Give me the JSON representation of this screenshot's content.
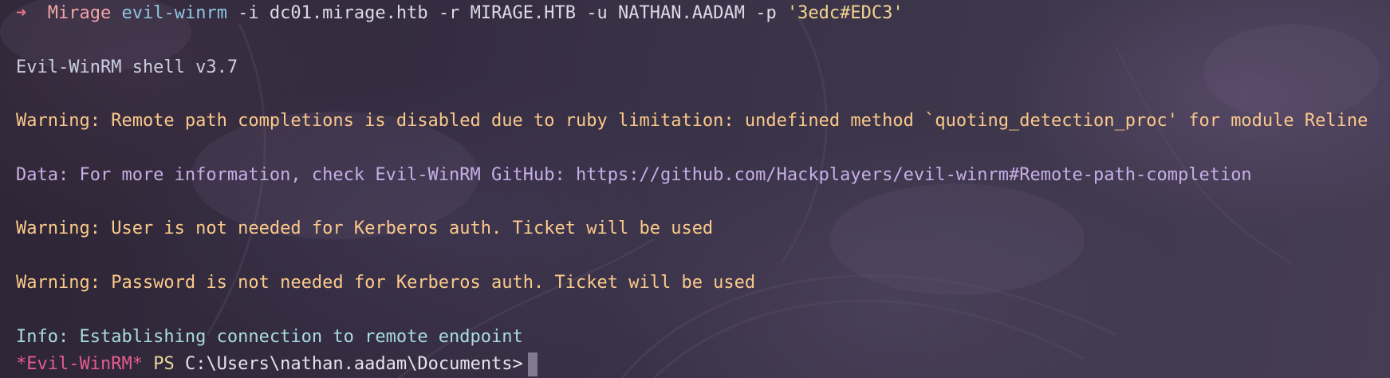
{
  "prompt": {
    "arrow": "➜",
    "directory": "Mirage",
    "command": "evil-winrm",
    "args": " -i dc01.mirage.htb -r MIRAGE.HTB -u NATHAN.AADAM -p ",
    "password_arg": "'3edc#EDC3'"
  },
  "output": {
    "banner": "Evil-WinRM shell v3.7",
    "warning_completion": "Warning: Remote path completions is disabled due to ruby limitation: undefined method `quoting_detection_proc' for module Reline",
    "data_info": "Data: For more information, check Evil-WinRM GitHub: https://github.com/Hackplayers/evil-winrm#Remote-path-completion",
    "warning_user": "Warning: User is not needed for Kerberos auth. Ticket will be used",
    "warning_password": "Warning: Password is not needed for Kerberos auth. Ticket will be used",
    "info_connect": "Info: Establishing connection to remote endpoint"
  },
  "shell_prompt": {
    "name": "*Evil-WinRM*",
    "ps": "PS",
    "path": "C:\\Users\\nathan.aadam\\Documents>"
  },
  "colors": {
    "warning": "#fbc98a",
    "data": "#c7aee6",
    "info": "#a9dde0",
    "command": "#8ec6e0",
    "prompt_arrow": "#e27484",
    "evil_winrm_prompt": "#e45c8f"
  }
}
